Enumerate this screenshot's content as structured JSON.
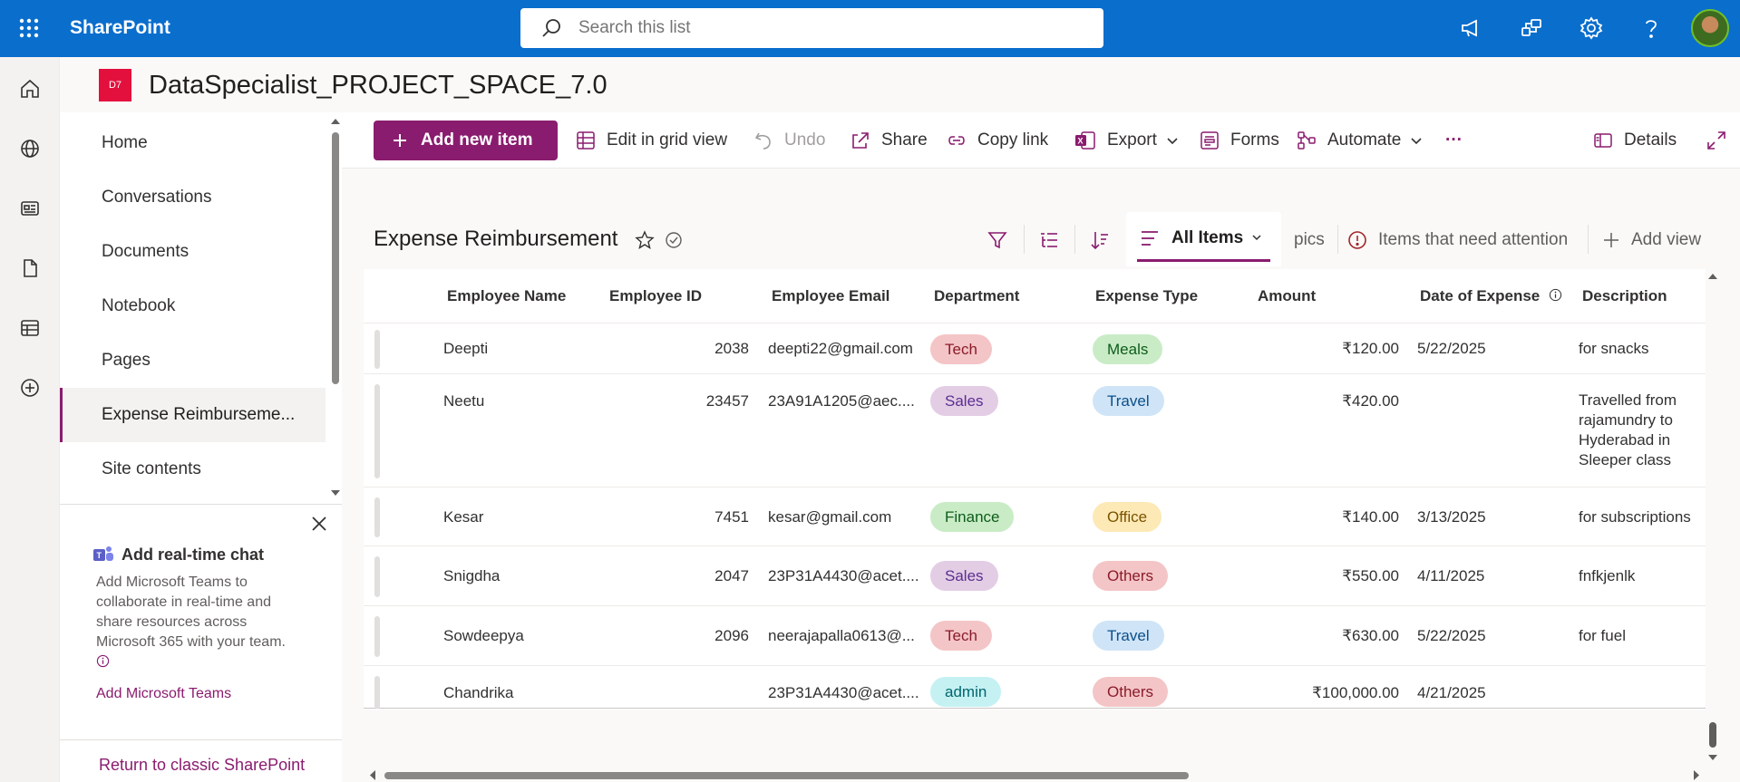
{
  "suite": {
    "brand": "SharePoint",
    "search_placeholder": "Search this list",
    "icons": [
      "app-launcher-icon",
      "megaphone-icon",
      "share-network-icon",
      "gear-icon",
      "help-icon"
    ]
  },
  "site": {
    "logo_text": "D7",
    "title": "DataSpecialist_PROJECT_SPACE_7.0"
  },
  "leftnav": {
    "items": [
      {
        "label": "Home"
      },
      {
        "label": "Conversations"
      },
      {
        "label": "Documents"
      },
      {
        "label": "Notebook"
      },
      {
        "label": "Pages"
      },
      {
        "label": "Expense Reimburseme..."
      },
      {
        "label": "Site contents"
      }
    ],
    "selected_index": 5,
    "chat": {
      "title": "Add real-time chat",
      "description": "Add Microsoft Teams to collaborate in real-time and share resources across Microsoft 365 with your team.",
      "link": "Add Microsoft Teams"
    },
    "classic_link": "Return to classic SharePoint"
  },
  "commandbar": {
    "add_new": "Add new item",
    "edit_grid": "Edit in grid view",
    "undo": "Undo",
    "share": "Share",
    "copy_link": "Copy link",
    "export": "Export",
    "forms": "Forms",
    "automate": "Automate",
    "more": "···",
    "details": "Details"
  },
  "list": {
    "title": "Expense Reimbursement",
    "views": {
      "current": "All Items",
      "pics": "pics",
      "attention": "Items that need attention",
      "add_view": "Add view"
    },
    "columns": {
      "name": "Employee Name",
      "id": "Employee ID",
      "email": "Employee Email",
      "dept": "Department",
      "type": "Expense Type",
      "amount": "Amount",
      "date": "Date of Expense",
      "desc": "Description"
    },
    "rows": [
      {
        "name": "Deepti",
        "id": "2038",
        "email": "deepti22@gmail.com",
        "dept": "Tech",
        "type": "Meals",
        "amount": "₹120.00",
        "date": "5/22/2025",
        "desc": "for snacks"
      },
      {
        "name": "Neetu",
        "id": "23457",
        "email": "23A91A1205@aec....",
        "dept": "Sales",
        "type": "Travel",
        "amount": "₹420.00",
        "date": "",
        "desc": "Travelled from rajamundry to Hyderabad in Sleeper class"
      },
      {
        "name": "Kesar",
        "id": "7451",
        "email": "kesar@gmail.com",
        "dept": "Finance",
        "type": "Office",
        "amount": "₹140.00",
        "date": "3/13/2025",
        "desc": "for subscriptions"
      },
      {
        "name": "Snigdha",
        "id": "2047",
        "email": "23P31A4430@acet....",
        "dept": "Sales",
        "type": "Others",
        "amount": "₹550.00",
        "date": "4/11/2025",
        "desc": "fnfkjenlk"
      },
      {
        "name": "Sowdeepya",
        "id": "2096",
        "email": "neerajapalla0613@...",
        "dept": "Tech",
        "type": "Travel",
        "amount": "₹630.00",
        "date": "5/22/2025",
        "desc": "for fuel"
      },
      {
        "name": "Chandrika",
        "id": "",
        "email": "23P31A4430@acet....",
        "dept": "admin",
        "type": "Others",
        "amount": "₹100,000.00",
        "date": "4/21/2025",
        "desc": ""
      }
    ]
  },
  "colors": {
    "suite": "#0a6ecd",
    "accent": "#8a1c6f",
    "pill_tech": "#f4c5c6",
    "pill_sales": "#e3cde5",
    "pill_finance": "#c9ecc7",
    "pill_admin": "#c5f1f3",
    "pill_meals": "#c9ecc7",
    "pill_travel": "#cfe4f7",
    "pill_office": "#fde9b6",
    "pill_others": "#f4c5c6"
  }
}
